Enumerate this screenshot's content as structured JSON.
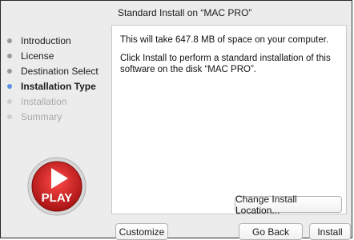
{
  "header": {
    "step_title": "Standard Install on “MAC PRO”"
  },
  "sidebar": {
    "items": [
      {
        "label": "Introduction",
        "state": "done"
      },
      {
        "label": "License",
        "state": "done"
      },
      {
        "label": "Destination Select",
        "state": "done"
      },
      {
        "label": "Installation Type",
        "state": "current"
      },
      {
        "label": "Installation",
        "state": "pending"
      },
      {
        "label": "Summary",
        "state": "pending"
      }
    ]
  },
  "content": {
    "space_message": "This will take 647.8 MB of space on your computer.",
    "install_message": "Click Install to perform a standard installation of this software on the disk “MAC PRO”.",
    "change_location_label": "Change Install Location..."
  },
  "footer": {
    "customize_label": "Customize",
    "go_back_label": "Go Back",
    "install_label": "Install"
  },
  "logo": {
    "text": "PLAY",
    "ring_color": "#d62a2a",
    "accent_color": "#b01818"
  },
  "colors": {
    "current_step_dot": "#5c8fe0"
  }
}
